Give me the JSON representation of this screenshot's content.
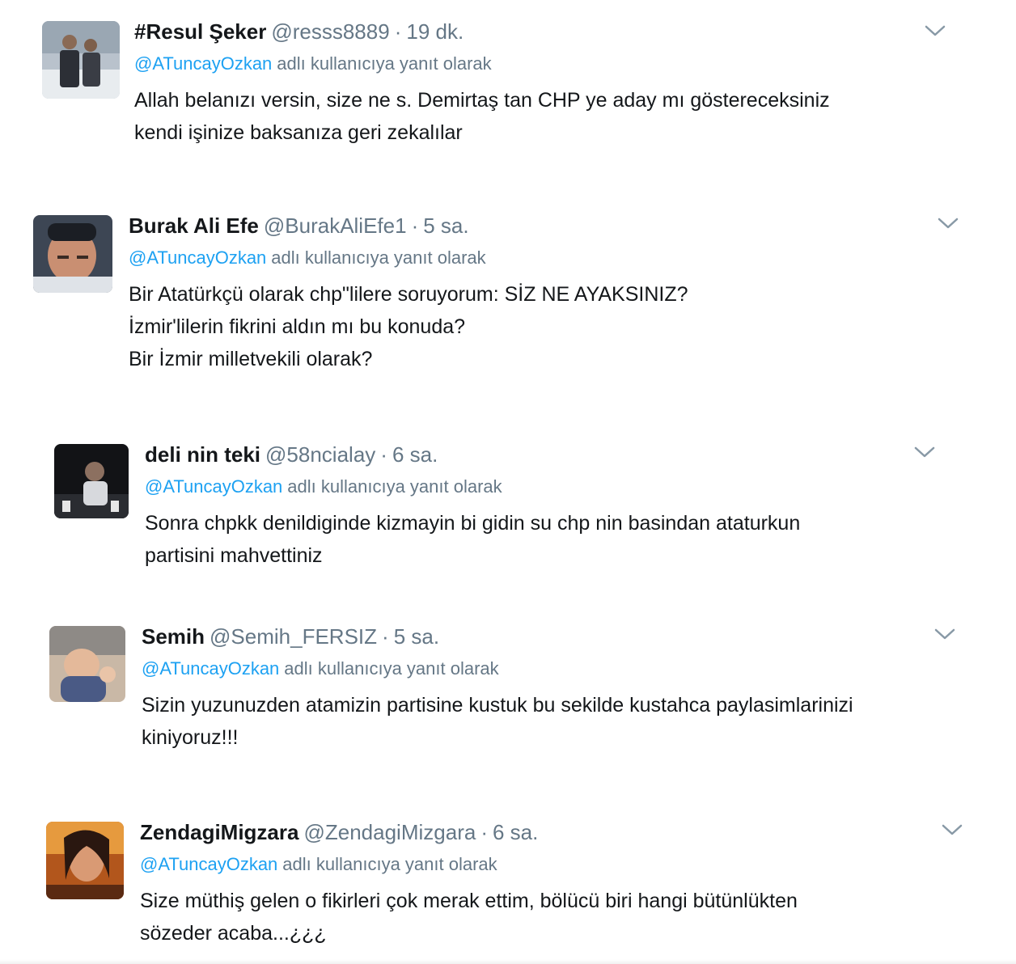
{
  "colors": {
    "link": "#1da1f2",
    "meta": "#657786",
    "text": "#14171a"
  },
  "reply_text": "adlı kullanıcıya yanıt olarak",
  "tweets": [
    {
      "name": "#Resul Şeker",
      "handle": "@resss8889",
      "sep": "·",
      "time": "19 dk.",
      "mention": "@ATuncayOzkan",
      "lines": [
        "Allah belanızı versin, size ne s. Demirtaş tan CHP ye aday mı göstereceksiniz",
        "kendi işinize baksanıza geri zekalılar"
      ],
      "menu_icon": "chevron-down-icon"
    },
    {
      "name": "Burak Ali Efe",
      "handle": "@BurakAliEfe1",
      "sep": "·",
      "time": "5 sa.",
      "mention": "@ATuncayOzkan",
      "lines": [
        "Bir Atatürkçü olarak chp\"lilere soruyorum: SİZ NE AYAKSINIZ?",
        "İzmir'lilerin fikrini aldın mı bu konuda?",
        "Bir İzmir milletvekili olarak?"
      ],
      "menu_icon": "chevron-down-icon"
    },
    {
      "name": "deli nin teki",
      "handle": "@58ncialay",
      "sep": "·",
      "time": "6 sa.",
      "mention": "@ATuncayOzkan",
      "lines": [
        "Sonra chpkk denildiginde kizmayin bi gidin su chp nin basindan ataturkun",
        "partisini mahvettiniz"
      ],
      "menu_icon": "chevron-down-icon"
    },
    {
      "name": "Semih",
      "handle": "@Semih_FERSIZ",
      "sep": "·",
      "time": "5 sa.",
      "mention": "@ATuncayOzkan",
      "lines": [
        "Sizin yuzunuzden atamizin partisine kustuk bu sekilde kustahca paylasimlarinizi",
        "kiniyoruz!!!"
      ],
      "menu_icon": "chevron-down-icon"
    },
    {
      "name": "ZendagiMigzara",
      "handle": "@ZendagiMizgara",
      "sep": "·",
      "time": "6 sa.",
      "mention": "@ATuncayOzkan",
      "lines": [
        "Size müthiş gelen o fikirleri çok merak ettim, bölücü biri hangi bütünlükten",
        "sözeder acaba...¿¿¿"
      ],
      "menu_icon": "chevron-down-icon"
    }
  ]
}
